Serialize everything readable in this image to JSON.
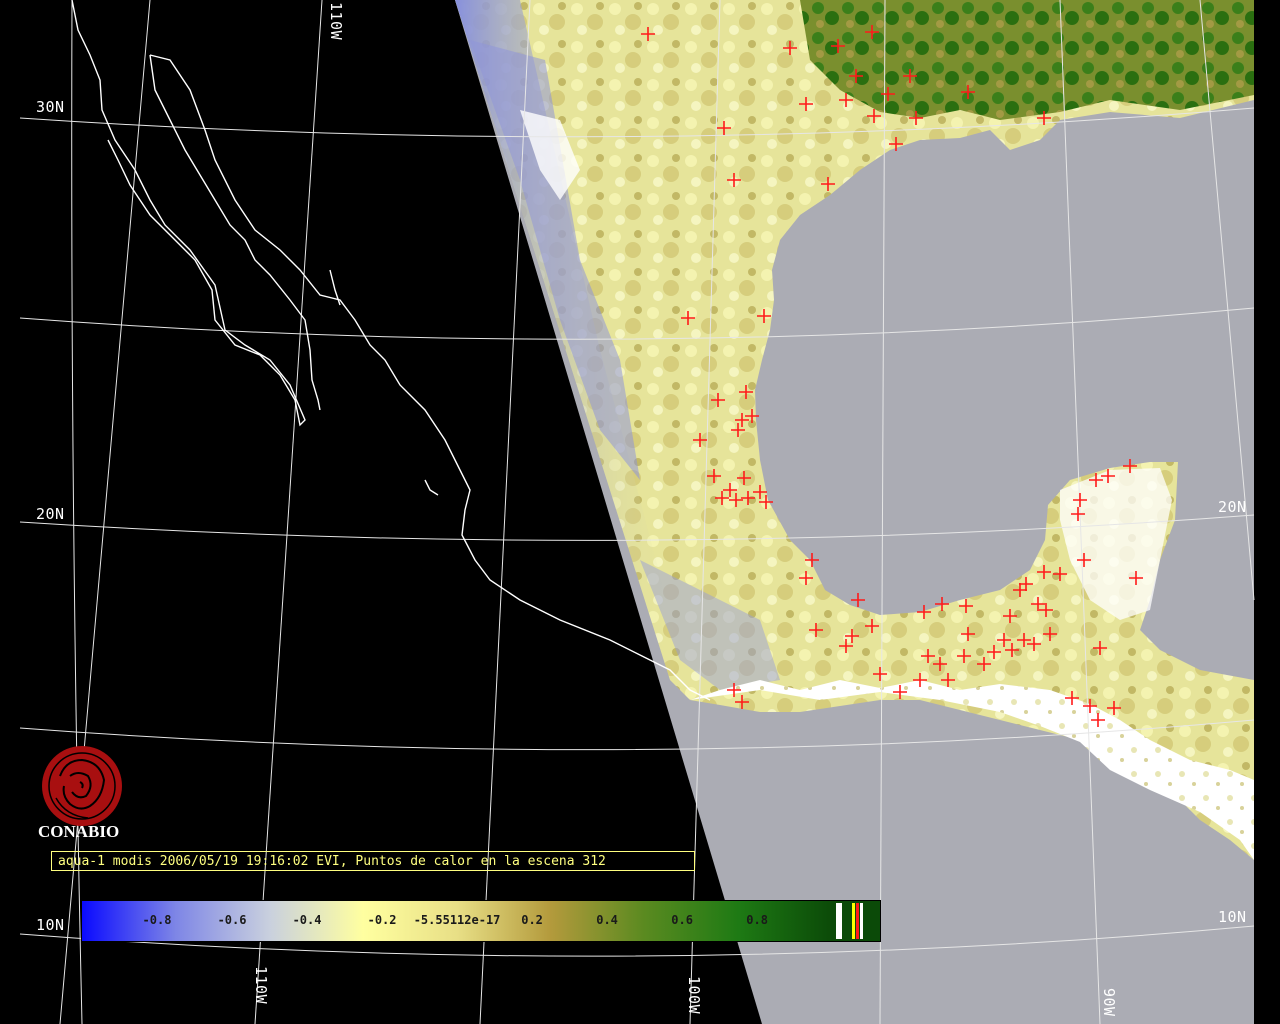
{
  "map": {
    "grid_labels": {
      "lat_30n": "30N",
      "lat_20n_left": "20N",
      "lat_10n_left": "10N",
      "lat_20n_right": "20N",
      "lat_10n_right": "10N",
      "lon_110w_top": "110W",
      "lon_110w_bottom": "110W",
      "lon_100w_bottom": "100W",
      "lon_90w_bottom": "90W"
    },
    "colors": {
      "background": "#000000",
      "sea": "#abacb4",
      "grid": "#e6e6e6",
      "coastline": "#ffffff",
      "cloud": "#ffffff",
      "hotspot": "#ff1a1a",
      "vegetation_low": "#f0f2a0",
      "vegetation_mid": "#b3a84b",
      "vegetation_high": "#2f7d1a"
    },
    "hotspot_symbol": "red-cross-icon"
  },
  "logo": {
    "name": "CONABIO",
    "icon": "conabio-seal-icon",
    "color": "#a80f10"
  },
  "caption": {
    "text": "aqua-1 modis 2006/05/19 19:16:02 EVI, Puntos de calor en la escena 312"
  },
  "legend": {
    "ticks": [
      "-0.8",
      "-0.6",
      "-0.4",
      "-0.2",
      "-5.55112e-17",
      "0.2",
      "0.4",
      "0.6",
      "0.8"
    ],
    "tick_values": [
      -0.8,
      -0.6,
      -0.4,
      -0.2,
      0,
      0.2,
      0.4,
      0.6,
      0.8
    ],
    "range": [
      -1,
      1
    ],
    "gradient_colors": [
      "#0a0aff",
      "#7e86e6",
      "#c9d0de",
      "#ffffa0",
      "#e8df86",
      "#b39a3c",
      "#5a8a20",
      "#1e7a14",
      "#0b4a08"
    ]
  }
}
